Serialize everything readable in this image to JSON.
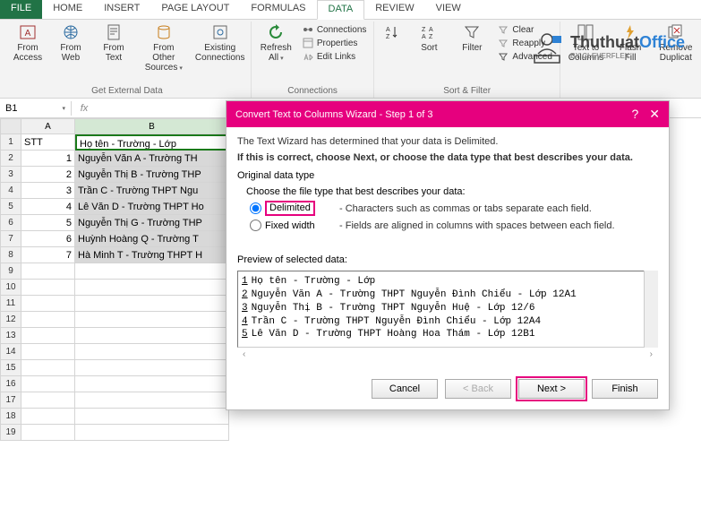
{
  "tabs": [
    "FILE",
    "HOME",
    "INSERT",
    "PAGE LAYOUT",
    "FORMULAS",
    "DATA",
    "REVIEW",
    "VIEW"
  ],
  "active_tab": "DATA",
  "ribbon": {
    "get_external": {
      "label": "Get External Data",
      "items": [
        "From Access",
        "From Web",
        "From Text",
        "From Other Sources",
        "Existing Connections"
      ]
    },
    "connections": {
      "refresh": "Refresh All",
      "items": [
        "Connections",
        "Properties",
        "Edit Links"
      ],
      "label": "Connections"
    },
    "sort_filter": {
      "sort": "Sort",
      "filter": "Filter",
      "items": [
        "Clear",
        "Reapply",
        "Advanced"
      ],
      "label": "Sort & Filter"
    },
    "data_tools": {
      "items": [
        "Text to Columns",
        "Flash Fill",
        "Remove Duplicat"
      ]
    }
  },
  "watermark": {
    "brand_a": "Thuthuat",
    "brand_b": "Office",
    "sub": "BY CLEVERFLEX"
  },
  "namebox": "B1",
  "columns": [
    "A",
    "B"
  ],
  "header_row": {
    "stt": "STT",
    "name": "Họ tên - Trường - Lớp"
  },
  "data_rows": [
    {
      "n": "1",
      "v": "Nguyễn Văn A - Trường TH"
    },
    {
      "n": "2",
      "v": "Nguyễn Thị B - Trường THP"
    },
    {
      "n": "3",
      "v": "Trần C - Trường THPT Ngu"
    },
    {
      "n": "4",
      "v": "Lê Văn D - Trường THPT Ho"
    },
    {
      "n": "5",
      "v": "Nguyễn Thị G - Trường THP"
    },
    {
      "n": "6",
      "v": "Huỳnh Hoàng Q - Trường T"
    },
    {
      "n": "7",
      "v": "Hà Minh T - Trường THPT H"
    }
  ],
  "blank_rows": 11,
  "dialog": {
    "title": "Convert Text to Columns Wizard - Step 1 of 3",
    "line1": "The Text Wizard has determined that your data is Delimited.",
    "line2": "If this is correct, choose Next, or choose the data type that best describes your data.",
    "original_label": "Original data type",
    "choose_label": "Choose the file type that best describes your data:",
    "opt_delim": "Delimited",
    "opt_delim_desc": "- Characters such as commas or tabs separate each field.",
    "opt_fixed": "Fixed width",
    "opt_fixed_desc": "- Fields are aligned in columns with spaces between each field.",
    "preview_label": "Preview of selected data:",
    "preview": [
      "Họ tên - Trường - Lớp",
      "Nguyễn Văn A - Trường THPT Nguyễn Đình Chiểu - Lớp 12A1",
      "Nguyễn Thị B - Trường THPT Nguyễn Huệ - Lớp 12/6",
      "Trần C - Trường THPT Nguyễn Đình Chiểu - Lớp 12A4",
      "Lê Văn D - Trường THPT Hoàng Hoa Thám - Lớp 12B1"
    ],
    "btn_cancel": "Cancel",
    "btn_back": "< Back",
    "btn_next": "Next >",
    "btn_finish": "Finish"
  }
}
